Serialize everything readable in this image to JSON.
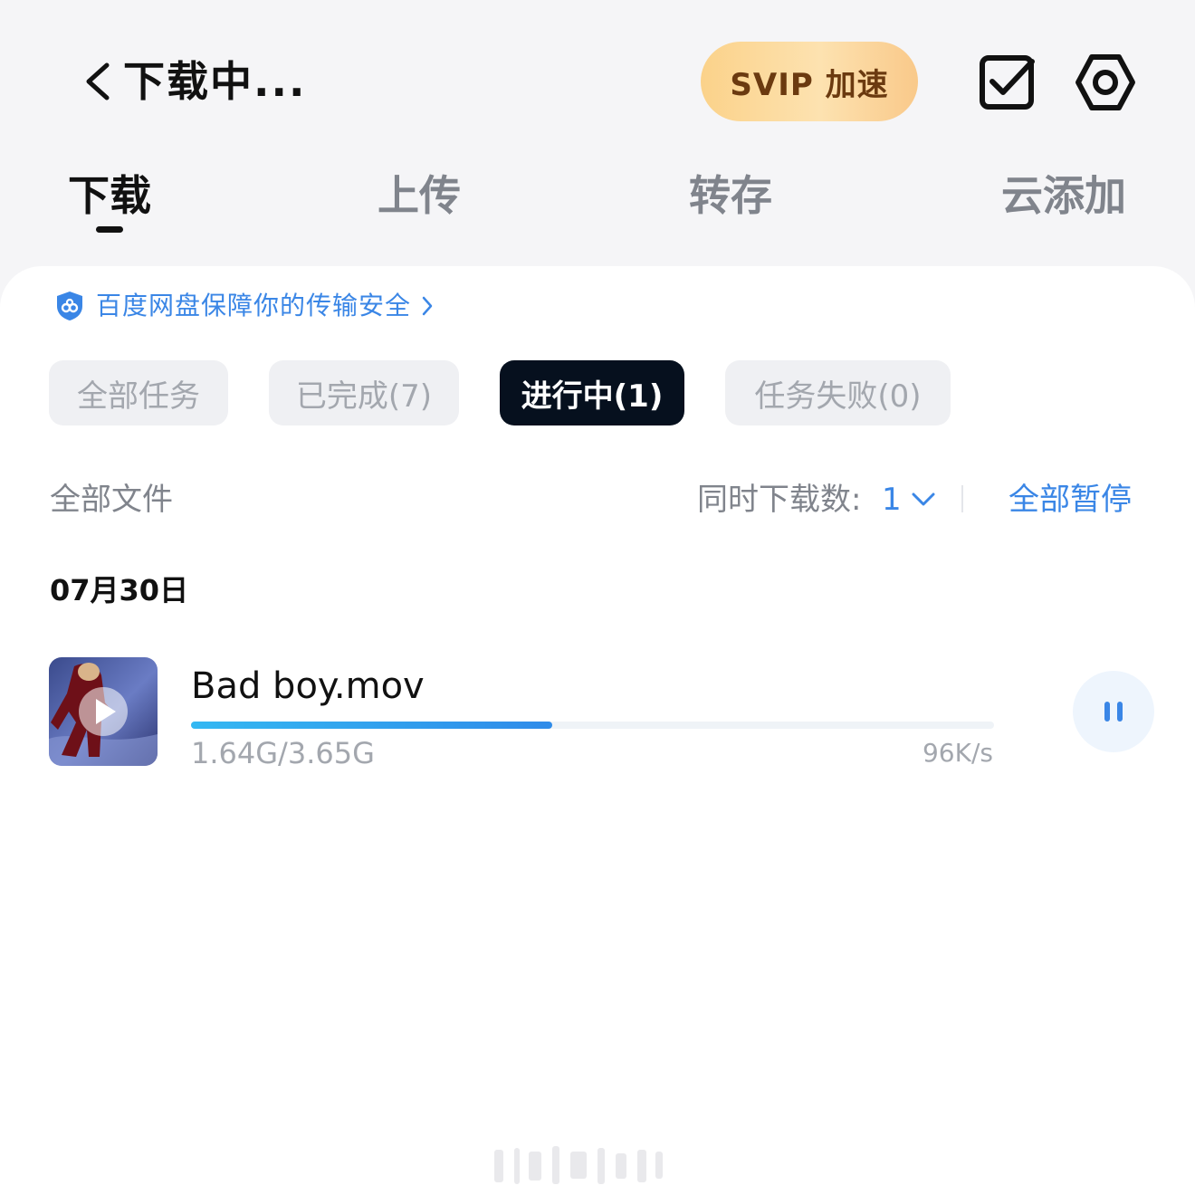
{
  "header": {
    "title": "下载中...",
    "svip_label": "SVIP 加速"
  },
  "tabs": [
    {
      "label": "下载",
      "active": true
    },
    {
      "label": "上传",
      "active": false
    },
    {
      "label": "转存",
      "active": false
    },
    {
      "label": "云添加",
      "active": false
    }
  ],
  "security_notice": "百度网盘保障你的传输安全",
  "filters": [
    {
      "label": "全部任务",
      "active": false
    },
    {
      "label": "已完成(7)",
      "active": false
    },
    {
      "label": "进行中(1)",
      "active": true
    },
    {
      "label": "任务失败(0)",
      "active": false
    }
  ],
  "toolbar": {
    "all_files": "全部文件",
    "concurrent_label": "同时下载数:",
    "concurrent_value": "1",
    "pause_all": "全部暂停"
  },
  "date_header": "07月30日",
  "download": {
    "file_name": "Bad boy.mov",
    "size": "1.64G/3.65G",
    "speed": "96K/s",
    "progress": 0.45
  },
  "colors": {
    "accent": "#3a86e6",
    "active_chip": "#06101e",
    "svip_text": "#6b3a10"
  },
  "icons": {
    "back": "chevron-left-icon",
    "select": "checkbox-icon",
    "settings": "gear-icon",
    "shield": "shield-icon",
    "pause": "pause-icon",
    "play": "play-icon"
  }
}
